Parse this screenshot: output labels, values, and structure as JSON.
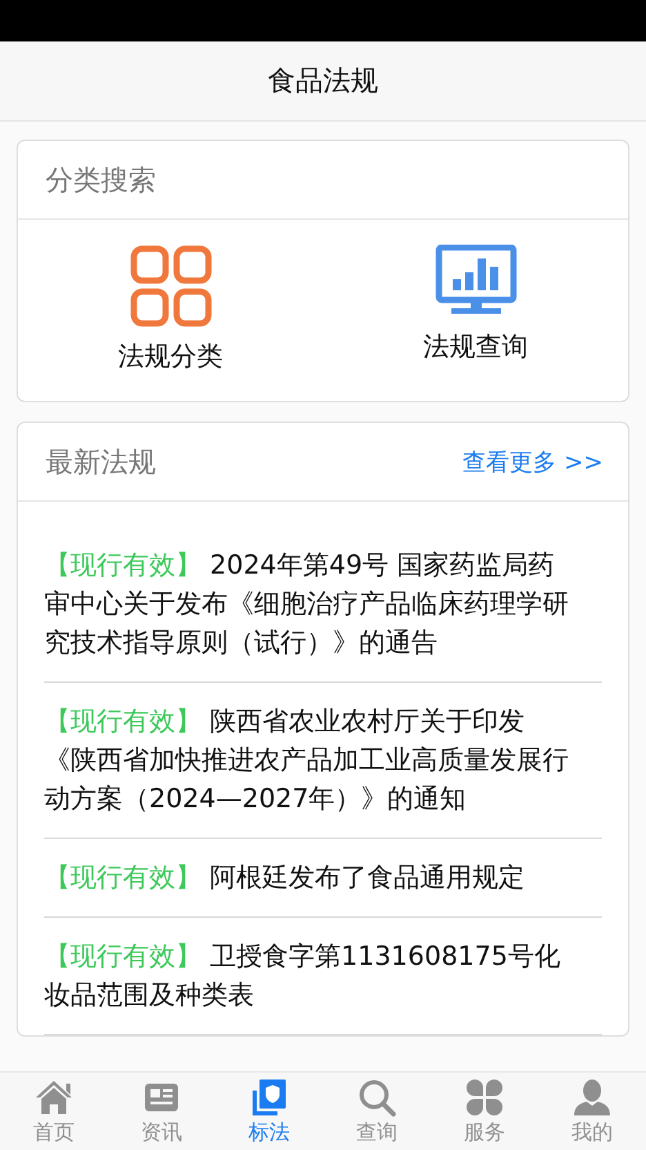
{
  "header": {
    "title": "食品法规"
  },
  "category_search": {
    "title": "分类搜索",
    "items": [
      {
        "kind": "grid",
        "label": "法规分类"
      },
      {
        "kind": "monitor",
        "label": "法规查询"
      }
    ]
  },
  "latest": {
    "title": "最新法规",
    "more": "查看更多 >>",
    "items": [
      {
        "status": "【现行有效】",
        "title": "2024年第49号 国家药监局药审中心关于发布《细胞治疗产品临床药理学研究技术指导原则（试行）》的通告"
      },
      {
        "status": "【现行有效】",
        "title": "陕西省农业农村厅关于印发《陕西省加快推进农产品加工业高质量发展行动方案（2024—2027年）》的通知"
      },
      {
        "status": "【现行有效】",
        "title": "阿根廷发布了食品通用规定"
      },
      {
        "status": "【现行有效】",
        "title": "卫授食字第1131608175号化妆品范围及种类表"
      }
    ]
  },
  "tabs": [
    {
      "kind": "home",
      "label": "首页",
      "selected": false
    },
    {
      "kind": "news",
      "label": "资讯",
      "selected": false
    },
    {
      "kind": "law",
      "label": "标法",
      "selected": true
    },
    {
      "kind": "search",
      "label": "查询",
      "selected": false
    },
    {
      "kind": "service",
      "label": "服务",
      "selected": false
    },
    {
      "kind": "user",
      "label": "我的",
      "selected": false
    }
  ]
}
